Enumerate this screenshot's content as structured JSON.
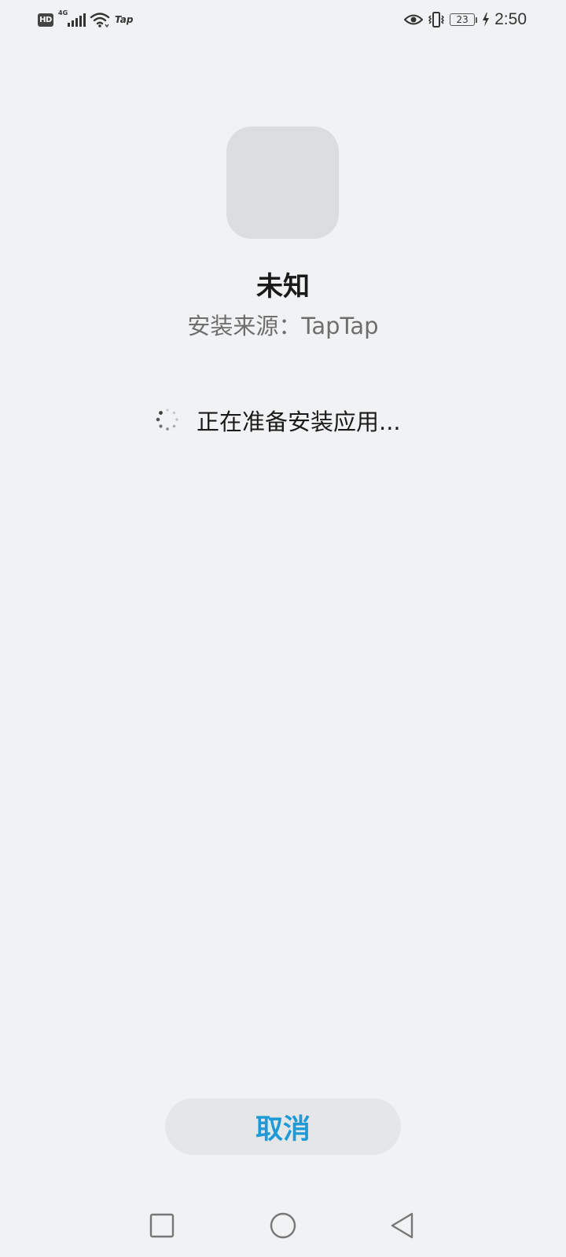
{
  "status_bar": {
    "hd_label": "HD",
    "network_type": "4G",
    "carrier_label": "Tap",
    "battery_level": "23",
    "time": "2:50",
    "icons": [
      "hd-icon",
      "signal-icon",
      "wifi-icon",
      "eye-icon",
      "vibrate-icon",
      "battery-icon",
      "charging-icon"
    ]
  },
  "app": {
    "name": "未知",
    "source": "安装来源：TapTap"
  },
  "progress": {
    "message": "正在准备安装应用...",
    "icon": "spinner-icon"
  },
  "actions": {
    "cancel_label": "取消"
  },
  "nav_bar": {
    "icons": [
      "recent-apps-icon",
      "home-icon",
      "back-icon"
    ]
  },
  "colors": {
    "background": "#f1f2f4",
    "accent": "#1e9ad6",
    "icon_placeholder": "#dcdde0",
    "button_background": "#e5e6e8"
  }
}
